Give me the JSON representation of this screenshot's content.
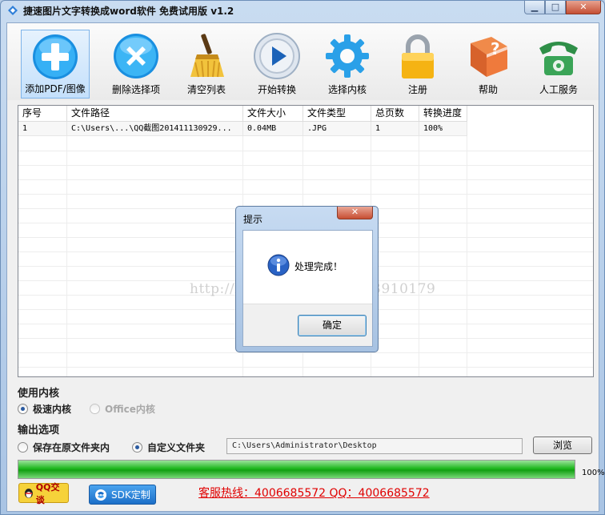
{
  "window": {
    "title": "捷速图片文字转换成word软件 免费试用版 v1.2",
    "controls": {
      "minimize": "▁",
      "maximize": "□",
      "close": "✕"
    }
  },
  "toolbar": {
    "items": [
      {
        "label": "添加PDF/图像",
        "icon": "add-icon"
      },
      {
        "label": "删除选择项",
        "icon": "delete-icon"
      },
      {
        "label": "清空列表",
        "icon": "broom-icon"
      },
      {
        "label": "开始转换",
        "icon": "play-icon"
      },
      {
        "label": "选择内核",
        "icon": "gear-icon"
      },
      {
        "label": "注册",
        "icon": "lock-icon"
      },
      {
        "label": "帮助",
        "icon": "help-book-icon"
      },
      {
        "label": "人工服务",
        "icon": "phone-icon"
      }
    ]
  },
  "file_table": {
    "columns": [
      "序号",
      "文件路径",
      "文件大小",
      "文件类型",
      "总页数",
      "转换进度"
    ],
    "rows": [
      [
        "1",
        "C:\\Users\\...\\QQ截图201411130929...",
        "0.04MB",
        ".JPG",
        "1",
        "100%"
      ]
    ]
  },
  "engine": {
    "section_label": "使用内核",
    "options": [
      {
        "label": "极速内核",
        "selected": true,
        "enabled": true
      },
      {
        "label": "Office内核",
        "selected": false,
        "enabled": false
      }
    ]
  },
  "output": {
    "section_label": "输出选项",
    "options": [
      {
        "label": "保存在原文件夹内",
        "selected": false
      },
      {
        "label": "自定义文件夹",
        "selected": true
      }
    ],
    "path_value": "C:\\Users\\Administrator\\Desktop",
    "browse_label": "浏览"
  },
  "progress": {
    "value": 1.0,
    "text": "100%"
  },
  "footer": {
    "qq_label": "QQ交谈",
    "sdk_label": "SDK定制",
    "hotline": "客服热线：4006685572 QQ：4006685572"
  },
  "watermark": "http://blog.csdn.net/qq_23910179",
  "dialog": {
    "title": "提示",
    "message": "处理完成！",
    "ok_label": "确定",
    "close_glyph": "✕"
  },
  "colors": {
    "accent_blue": "#2a5aa0",
    "progress_green": "#1fb81f",
    "hotline_red": "#e00000"
  }
}
